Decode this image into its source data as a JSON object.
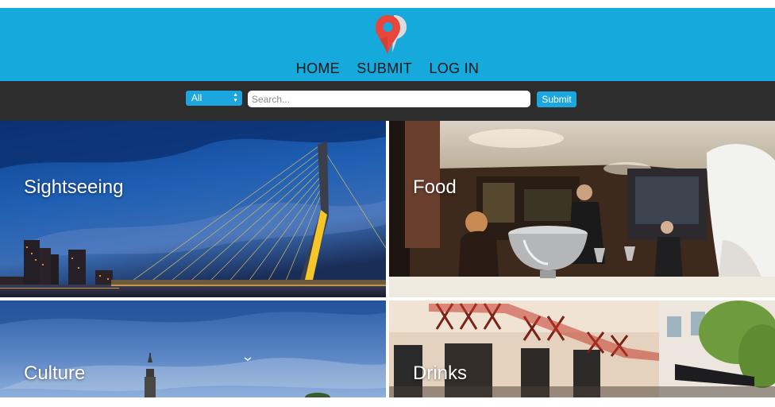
{
  "nav": {
    "home": "HOME",
    "submit": "SUBMIT",
    "login": "LOG IN"
  },
  "search": {
    "category_value": "All",
    "placeholder": "Search...",
    "submit_label": "Submit"
  },
  "tiles": [
    {
      "label": "Sightseeing"
    },
    {
      "label": "Food"
    },
    {
      "label": "Culture"
    },
    {
      "label": "Drinks"
    }
  ],
  "colors": {
    "header_bg": "#16a9dc",
    "search_bar_bg": "#2d2d2d",
    "accent": "#1ba6dd",
    "logo_red": "#e8453c",
    "logo_gray": "#d9d9d9"
  },
  "icons": {
    "logo": "location-pin-logo",
    "select_arrows": "up-down-arrows"
  }
}
